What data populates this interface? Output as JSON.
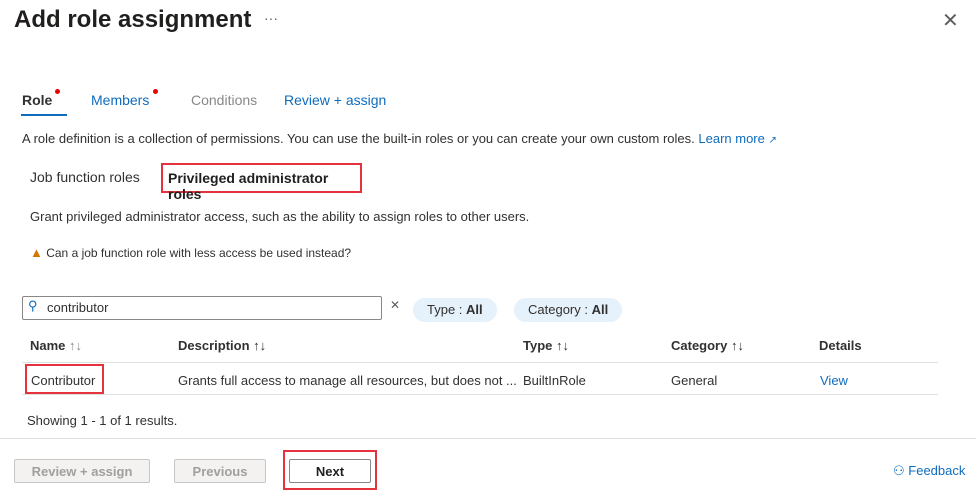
{
  "header": {
    "title": "Add role assignment",
    "more": "···",
    "close": "✕"
  },
  "tabs": [
    {
      "label": "Role",
      "required": true
    },
    {
      "label": "Members",
      "required": true
    },
    {
      "label": "Conditions"
    },
    {
      "label": "Review + assign"
    }
  ],
  "intro": {
    "text": "A role definition is a collection of permissions. You can use the built-in roles or you can create your own custom roles.",
    "link": "Learn more",
    "link_icon": "external-link-icon"
  },
  "role_types": {
    "job": "Job function roles",
    "privileged": "Privileged administrator roles"
  },
  "privileged_desc": "Grant privileged administrator access, such as the ability to assign roles to other users.",
  "warning": "Can a job function role with less access be used instead?",
  "search": {
    "value": "contributor",
    "clear": "✕"
  },
  "filters": [
    {
      "label": "Type : ",
      "value": "All"
    },
    {
      "label": "Category : ",
      "value": "All"
    }
  ],
  "table": {
    "headers": [
      "Name",
      "Description",
      "Type",
      "Category",
      "Details"
    ],
    "sort_icon": "↑↓",
    "rows": [
      {
        "name": "Contributor",
        "description": "Grants full access to manage all resources, but does not ...",
        "type": "BuiltInRole",
        "category": "General",
        "details": "View"
      }
    ]
  },
  "results": "Showing 1 - 1 of 1 results.",
  "footer": {
    "review": "Review + assign",
    "previous": "Previous",
    "next": "Next",
    "feedback": "Feedback"
  },
  "colors": {
    "accent": "#0f6cbd",
    "highlight": "#e5323f",
    "warning": "#d47500"
  }
}
